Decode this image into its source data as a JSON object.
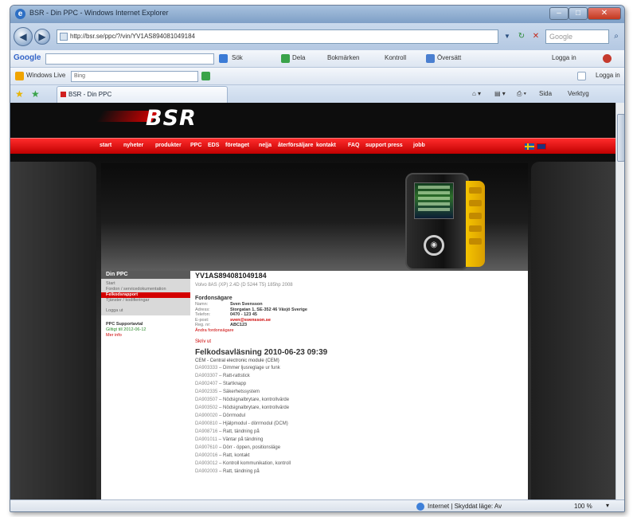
{
  "window": {
    "title": "BSR - Din PPC - Windows Internet Explorer",
    "buttons": {
      "minimize": "–",
      "maximize": "□",
      "close": "✕"
    }
  },
  "address_bar": {
    "url": "http://bsr.se/ppc/?/vin/YV1AS894081049184",
    "search_placeholder": "Google",
    "icons": [
      "back-icon",
      "forward-icon",
      "refresh-icon",
      "stop-icon",
      "search-icon"
    ]
  },
  "google_toolbar": {
    "logo": "Google",
    "items": [
      "Sök",
      "Dela",
      "Bokmärken",
      "Kontroll",
      "Översätt",
      "Logga in"
    ]
  },
  "live_toolbar": {
    "logo": "Windows Live",
    "field": "Bing",
    "right_item": "Logga in"
  },
  "tabs": {
    "active": "BSR - Din PPC",
    "command_items": [
      "Sida",
      "Verktyg"
    ]
  },
  "site": {
    "logo": "BSR",
    "nav": [
      "start",
      "nyheter",
      "produkter",
      "PPC",
      "EDS",
      "företaget",
      "ne|ja",
      "återförsäljare",
      "kontakt",
      "FAQ",
      "support",
      "press",
      "jobb"
    ],
    "sidebar": {
      "header": "Din PPC",
      "items": [
        "Start",
        "Fordon / servicedokumentation",
        "Felkodsrapport",
        "Tjänster / kodifieringar",
        "Logga ut"
      ],
      "active_index": 2,
      "support_title": "PPC Supportavtal",
      "support_lines": [
        "Giltigt till 2012-06-12",
        "Mer info"
      ]
    },
    "main": {
      "vin": "YV1AS894081049184",
      "vehicle": "Volvo 8AS (XP) 2.4D (D 5244 T5) 185hp 2008",
      "owner_title": "Fordonsägare",
      "owner_rows": [
        {
          "label": "Namn:",
          "value": "Sven Svensson",
          "red": false
        },
        {
          "label": "Adress:",
          "value": "Storgatan 1, SE-352 46 Växjö Sverige",
          "red": false
        },
        {
          "label": "Telefon:",
          "value": "0470 - 123 45",
          "red": false
        },
        {
          "label": "E-post:",
          "value": "sven@svensson.se",
          "red": true
        },
        {
          "label": "Reg. nr:",
          "value": "ABC123",
          "red": false
        }
      ],
      "change_owner": "Ändra fordonsägare",
      "print_link": "Skriv ut",
      "log_title": "Felkodsavläsning 2010-06-23 09:39",
      "module_line": "CEM - Central electronic module (CEM)",
      "codes": [
        {
          "code": "DA903333",
          "desc": "Dimmer ljusreglage ur funk"
        },
        {
          "code": "DA903307",
          "desc": "Ratt-rattstick"
        },
        {
          "code": "DA902407",
          "desc": "Startknapp"
        },
        {
          "code": "DA902335",
          "desc": "Säkerhetssystem"
        },
        {
          "code": "DA903507",
          "desc": "Nödsignalbrytare, kontrollvärde"
        },
        {
          "code": "DA903502",
          "desc": "Nödsignalbrytare, kontrollvärde"
        },
        {
          "code": "DA900020",
          "desc": "Dörrmodul"
        },
        {
          "code": "DA900810",
          "desc": "Hjälpmodul - dörrmodul (DCM)"
        },
        {
          "code": "DA908716",
          "desc": "Ratt, tändning på"
        },
        {
          "code": "DA901011",
          "desc": "Väntar på tändning"
        },
        {
          "code": "DA907610",
          "desc": "Dörr - öppen, positionsläge"
        },
        {
          "code": "DA902016",
          "desc": "Ratt, kontakt"
        },
        {
          "code": "DA903012",
          "desc": "Kontroll kommunikation, kontroll"
        },
        {
          "code": "DA902003",
          "desc": "Ratt, tändning på"
        }
      ]
    }
  },
  "status_bar": {
    "zone": "Internet | Skyddat läge: Av",
    "zoom": "100 %"
  },
  "colors": {
    "brand_red": "#d40000",
    "header_black": "#0d0d0d",
    "device_yellow": "#f5c400"
  }
}
